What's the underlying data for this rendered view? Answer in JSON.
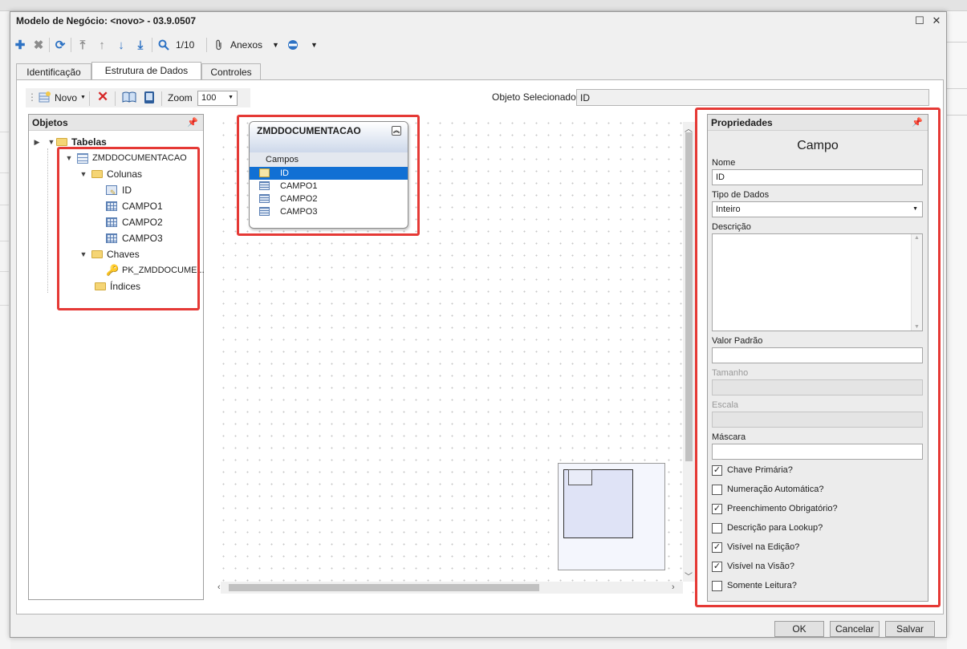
{
  "window": {
    "title": "Modelo de Negócio: <novo> - 03.9.0507",
    "maximize_glyph": "☐",
    "close_glyph": "✕"
  },
  "toolbar": {
    "page_indicator": "1/10",
    "anexos_label": "Anexos"
  },
  "tabs": [
    {
      "label": "Identificação"
    },
    {
      "label": "Estrutura de Dados"
    },
    {
      "label": "Controles"
    }
  ],
  "inner_toolbar": {
    "novo_label": "Novo",
    "zoom_label": "Zoom",
    "zoom_value": "100"
  },
  "selected_object": {
    "label": "Objeto Selecionado:",
    "value": "ID"
  },
  "objetos_panel": {
    "title": "Objetos",
    "tree": {
      "root": "Tabelas",
      "table": "ZMDDOCUMENTACAO",
      "colunas_label": "Colunas",
      "columns": [
        "ID",
        "CAMPO1",
        "CAMPO2",
        "CAMPO3"
      ],
      "chaves_label": "Chaves",
      "key": "PK_ZMDDOCUME...",
      "indices_label": "Índices"
    }
  },
  "entity": {
    "name": "ZMDDOCUMENTACAO",
    "section": "Campos",
    "fields": [
      "ID",
      "CAMPO1",
      "CAMPO2",
      "CAMPO3"
    ],
    "selected_field": "ID"
  },
  "properties_panel": {
    "title": "Propriedades",
    "heading": "Campo",
    "nome_label": "Nome",
    "nome_value": "ID",
    "tipo_label": "Tipo de Dados",
    "tipo_value": "Inteiro",
    "descricao_label": "Descrição",
    "valor_padrao_label": "Valor Padrão",
    "tamanho_label": "Tamanho",
    "escala_label": "Escala",
    "mascara_label": "Máscara",
    "checks": [
      {
        "label": "Chave Primária?",
        "checked": true
      },
      {
        "label": "Numeração Automática?",
        "checked": false
      },
      {
        "label": "Preenchimento Obrigatório?",
        "checked": true
      },
      {
        "label": "Descrição para Lookup?",
        "checked": false
      },
      {
        "label": "Visível na Edição?",
        "checked": true
      },
      {
        "label": "Visível na Visão?",
        "checked": true
      },
      {
        "label": "Somente Leitura?",
        "checked": false
      }
    ]
  },
  "buttons": {
    "ok": "OK",
    "cancel": "Cancelar",
    "save": "Salvar"
  },
  "colors": {
    "highlight": "#e53935",
    "selection": "#1170d4",
    "accent_icon": "#2d72c4"
  }
}
